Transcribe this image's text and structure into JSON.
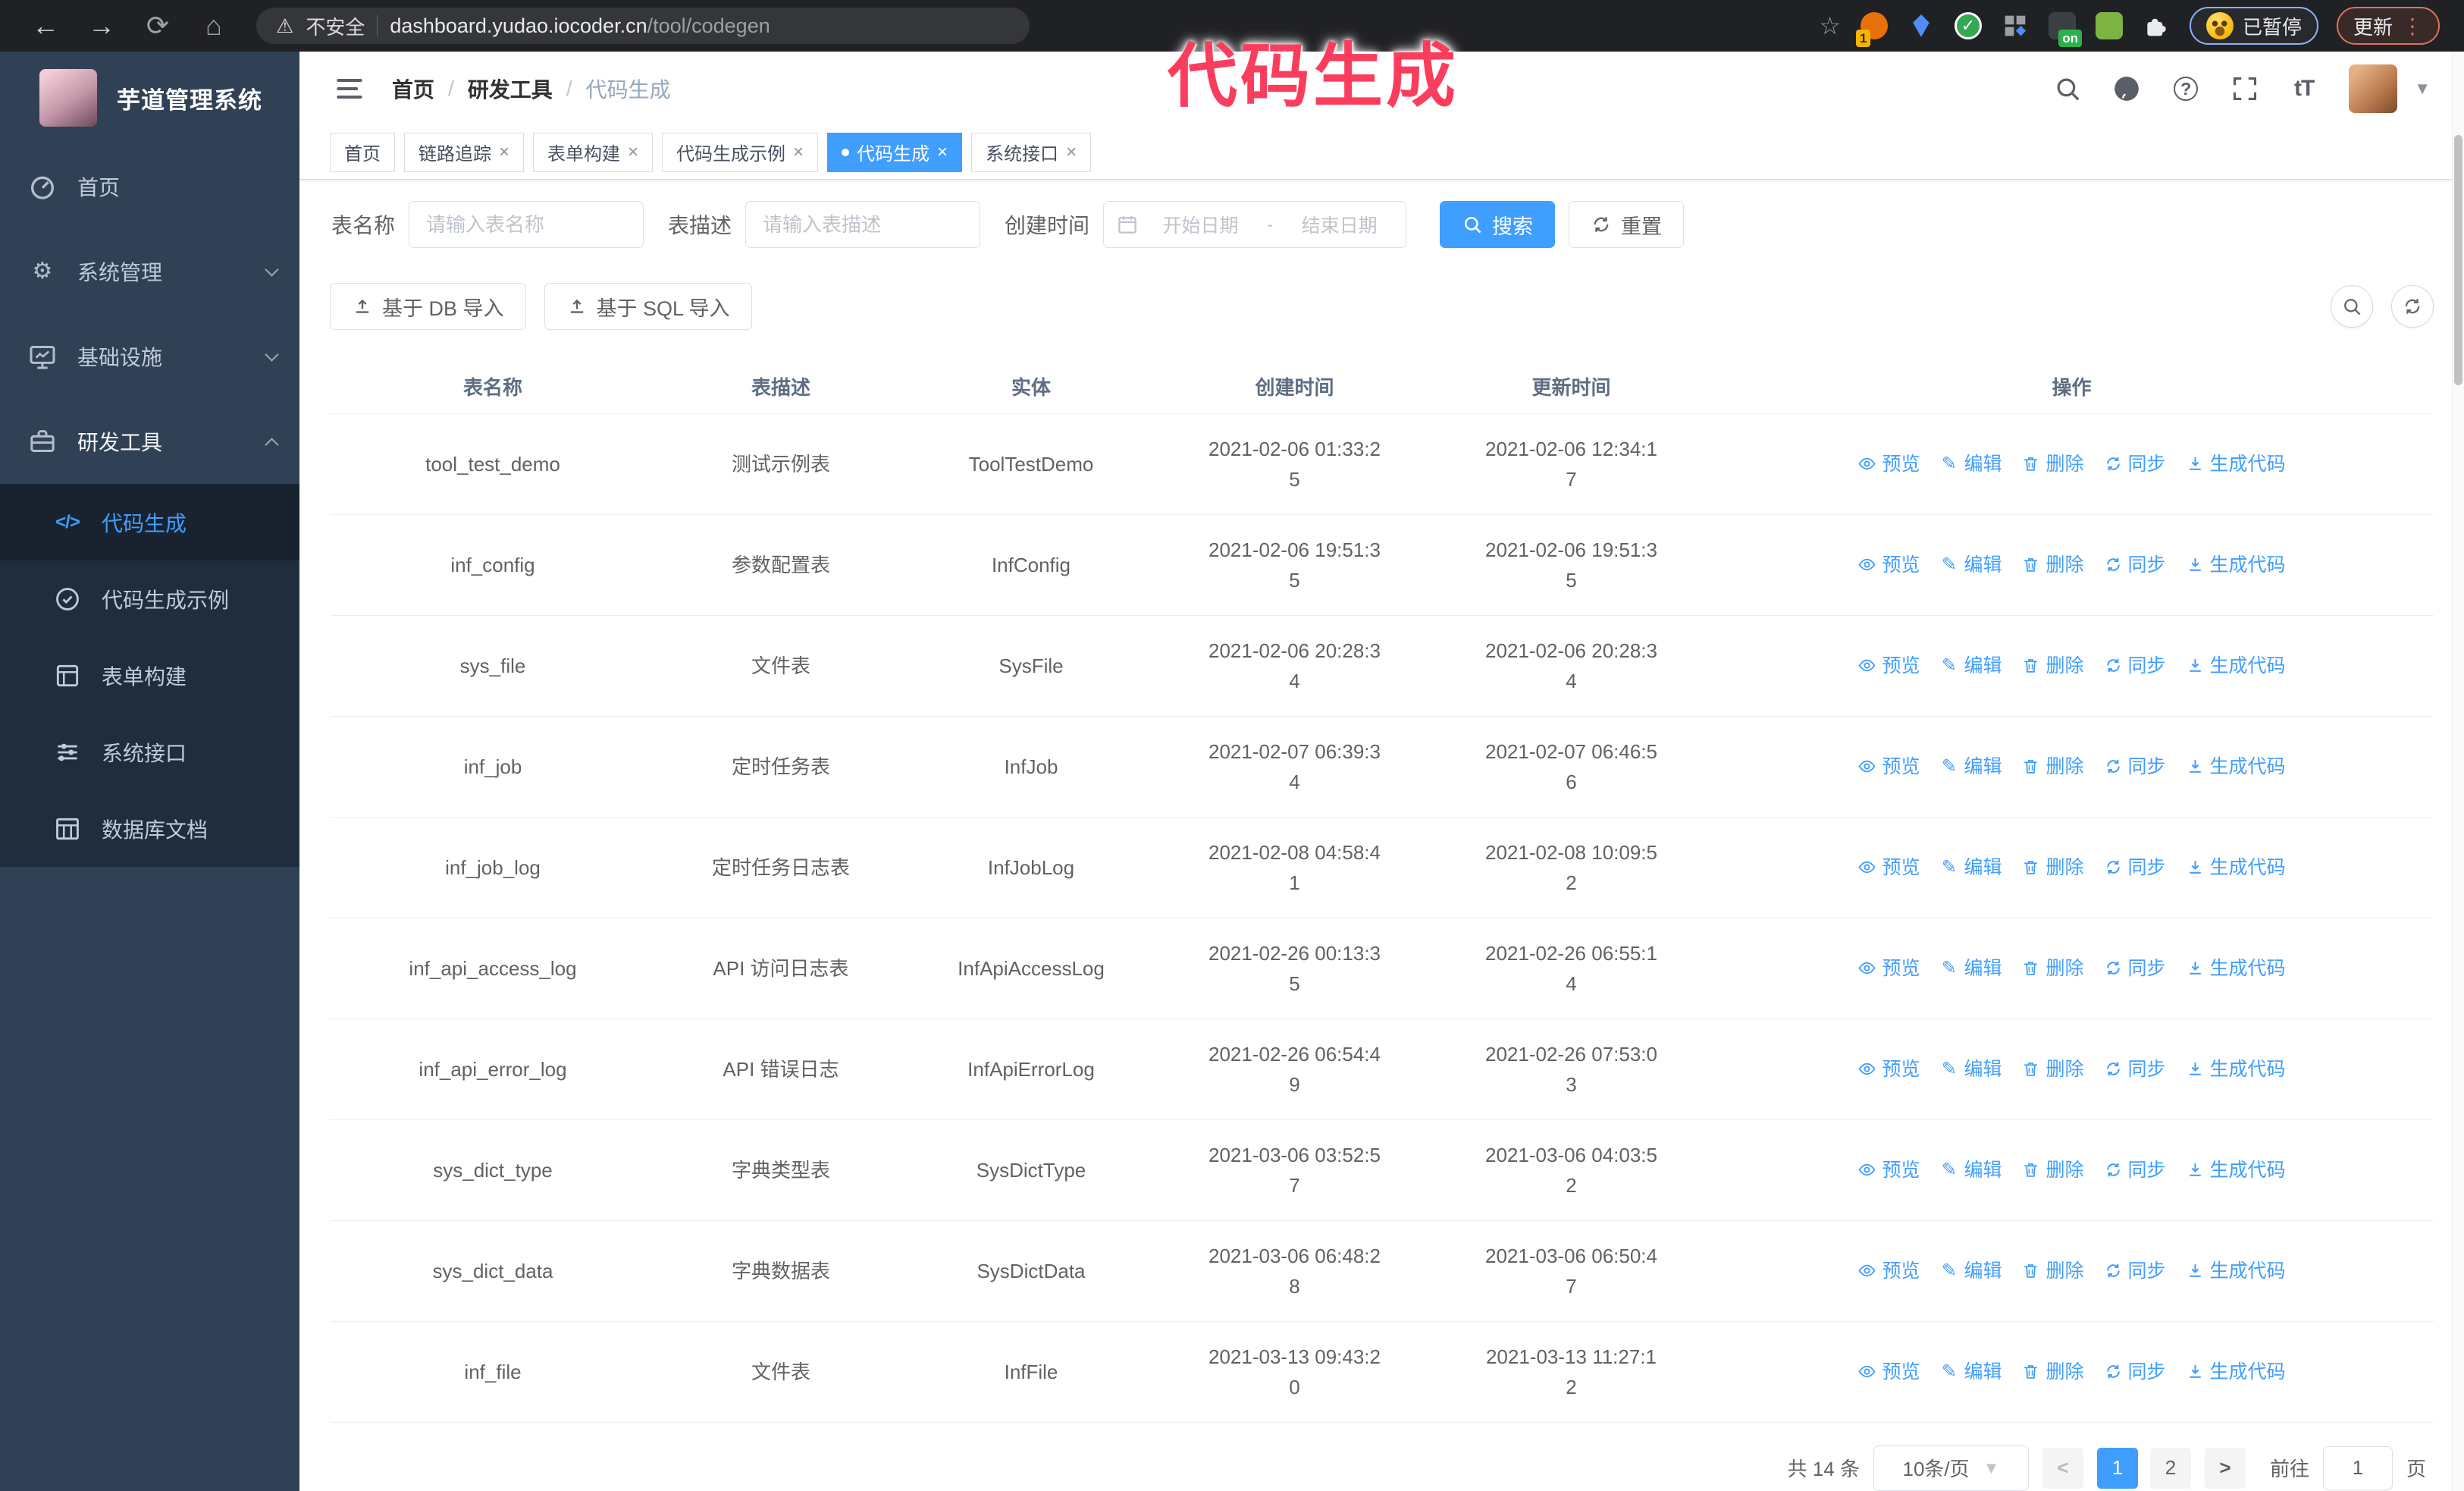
{
  "browser": {
    "security_label": "不安全",
    "url": "dashboard.yudao.iocoder.cn/tool/codegen",
    "profile_label": "已暂停",
    "update_label": "更新",
    "extensions": [
      {
        "name": "ext-orange-circle-icon",
        "badge": "1"
      },
      {
        "name": "ext-blue-gem-icon",
        "badge": ""
      },
      {
        "name": "ext-green-check-icon",
        "badge": ""
      },
      {
        "name": "ext-grid-diamond-icon",
        "badge": ""
      },
      {
        "name": "ext-dark-icon",
        "badge": "on"
      },
      {
        "name": "ext-green-bot-icon",
        "badge": ""
      },
      {
        "name": "ext-puzzle-icon",
        "badge": ""
      }
    ]
  },
  "overlay": {
    "text": "代码生成",
    "color": "#fb3d5d"
  },
  "sidebar": {
    "title": "芋道管理系统",
    "items": [
      {
        "id": "home",
        "label": "首页",
        "icon": "dashboard-icon",
        "expandable": false,
        "expanded": false,
        "active": false
      },
      {
        "id": "system",
        "label": "系统管理",
        "icon": "gear-icon",
        "expandable": true,
        "expanded": false,
        "active": false
      },
      {
        "id": "infra",
        "label": "基础设施",
        "icon": "monitor-icon",
        "expandable": true,
        "expanded": false,
        "active": false
      },
      {
        "id": "devtools",
        "label": "研发工具",
        "icon": "toolbox-icon",
        "expandable": true,
        "expanded": true,
        "active": true
      }
    ],
    "submenu": [
      {
        "id": "codegen",
        "label": "代码生成",
        "icon": "code-icon",
        "active": true
      },
      {
        "id": "codegen-demo",
        "label": "代码生成示例",
        "icon": "check-circle-icon",
        "active": false
      },
      {
        "id": "form-build",
        "label": "表单构建",
        "icon": "form-icon",
        "active": false
      },
      {
        "id": "system-api",
        "label": "系统接口",
        "icon": "sliders-icon",
        "active": false
      },
      {
        "id": "db-doc",
        "label": "数据库文档",
        "icon": "db-grid-icon",
        "active": false
      }
    ]
  },
  "header": {
    "breadcrumb": [
      "首页",
      "研发工具",
      "代码生成"
    ],
    "icons": [
      {
        "name": "search-icon"
      },
      {
        "name": "github-icon"
      },
      {
        "name": "question-icon"
      },
      {
        "name": "fullscreen-icon"
      },
      {
        "name": "font-size-icon"
      }
    ]
  },
  "tabs": [
    {
      "label": "首页",
      "closable": false,
      "active": false
    },
    {
      "label": "链路追踪",
      "closable": true,
      "active": false
    },
    {
      "label": "表单构建",
      "closable": true,
      "active": false
    },
    {
      "label": "代码生成示例",
      "closable": true,
      "active": false
    },
    {
      "label": "代码生成",
      "closable": true,
      "active": true
    },
    {
      "label": "系统接口",
      "closable": true,
      "active": false
    }
  ],
  "search": {
    "name_label": "表名称",
    "name_placeholder": "请输入表名称",
    "desc_label": "表描述",
    "desc_placeholder": "请输入表描述",
    "time_label": "创建时间",
    "start_placeholder": "开始日期",
    "range_separator": "-",
    "end_placeholder": "结束日期",
    "search_button": "搜索",
    "reset_button": "重置"
  },
  "toolbar": {
    "import_db_label": "基于 DB 导入",
    "import_sql_label": "基于 SQL 导入"
  },
  "table": {
    "columns": [
      "表名称",
      "表描述",
      "实体",
      "创建时间",
      "更新时间",
      "操作"
    ],
    "row_actions": [
      {
        "name": "preview",
        "label": "预览",
        "icon": "eye-icon"
      },
      {
        "name": "edit",
        "label": "编辑",
        "icon": "edit-icon"
      },
      {
        "name": "delete",
        "label": "删除",
        "icon": "trash-icon"
      },
      {
        "name": "sync",
        "label": "同步",
        "icon": "sync-icon"
      },
      {
        "name": "generate",
        "label": "生成代码",
        "icon": "download-icon"
      }
    ],
    "rows": [
      {
        "name": "tool_test_demo",
        "desc": "测试示例表",
        "entity": "ToolTestDemo",
        "created": "2021-02-06 01:33:25",
        "updated": "2021-02-06 12:34:17"
      },
      {
        "name": "inf_config",
        "desc": "参数配置表",
        "entity": "InfConfig",
        "created": "2021-02-06 19:51:35",
        "updated": "2021-02-06 19:51:35"
      },
      {
        "name": "sys_file",
        "desc": "文件表",
        "entity": "SysFile",
        "created": "2021-02-06 20:28:34",
        "updated": "2021-02-06 20:28:34"
      },
      {
        "name": "inf_job",
        "desc": "定时任务表",
        "entity": "InfJob",
        "created": "2021-02-07 06:39:34",
        "updated": "2021-02-07 06:46:56"
      },
      {
        "name": "inf_job_log",
        "desc": "定时任务日志表",
        "entity": "InfJobLog",
        "created": "2021-02-08 04:58:41",
        "updated": "2021-02-08 10:09:52"
      },
      {
        "name": "inf_api_access_log",
        "desc": "API 访问日志表",
        "entity": "InfApiAccessLog",
        "created": "2021-02-26 00:13:35",
        "updated": "2021-02-26 06:55:14"
      },
      {
        "name": "inf_api_error_log",
        "desc": "API 错误日志",
        "entity": "InfApiErrorLog",
        "created": "2021-02-26 06:54:49",
        "updated": "2021-02-26 07:53:03"
      },
      {
        "name": "sys_dict_type",
        "desc": "字典类型表",
        "entity": "SysDictType",
        "created": "2021-03-06 03:52:57",
        "updated": "2021-03-06 04:03:52"
      },
      {
        "name": "sys_dict_data",
        "desc": "字典数据表",
        "entity": "SysDictData",
        "created": "2021-03-06 06:48:28",
        "updated": "2021-03-06 06:50:47"
      },
      {
        "name": "inf_file",
        "desc": "文件表",
        "entity": "InfFile",
        "created": "2021-03-13 09:43:20",
        "updated": "2021-03-13 11:27:12"
      }
    ]
  },
  "pagination": {
    "total_text": "共 14 条",
    "page_size": "10条/页",
    "pages": [
      "1",
      "2"
    ],
    "active_page": "1",
    "goto_label": "前往",
    "goto_value": "1",
    "goto_suffix": "页"
  },
  "colors": {
    "accent": "#409eff",
    "sidebar_bg": "#304156",
    "submenu_bg": "#1f2d3d",
    "overlay": "#fb3d5d"
  }
}
